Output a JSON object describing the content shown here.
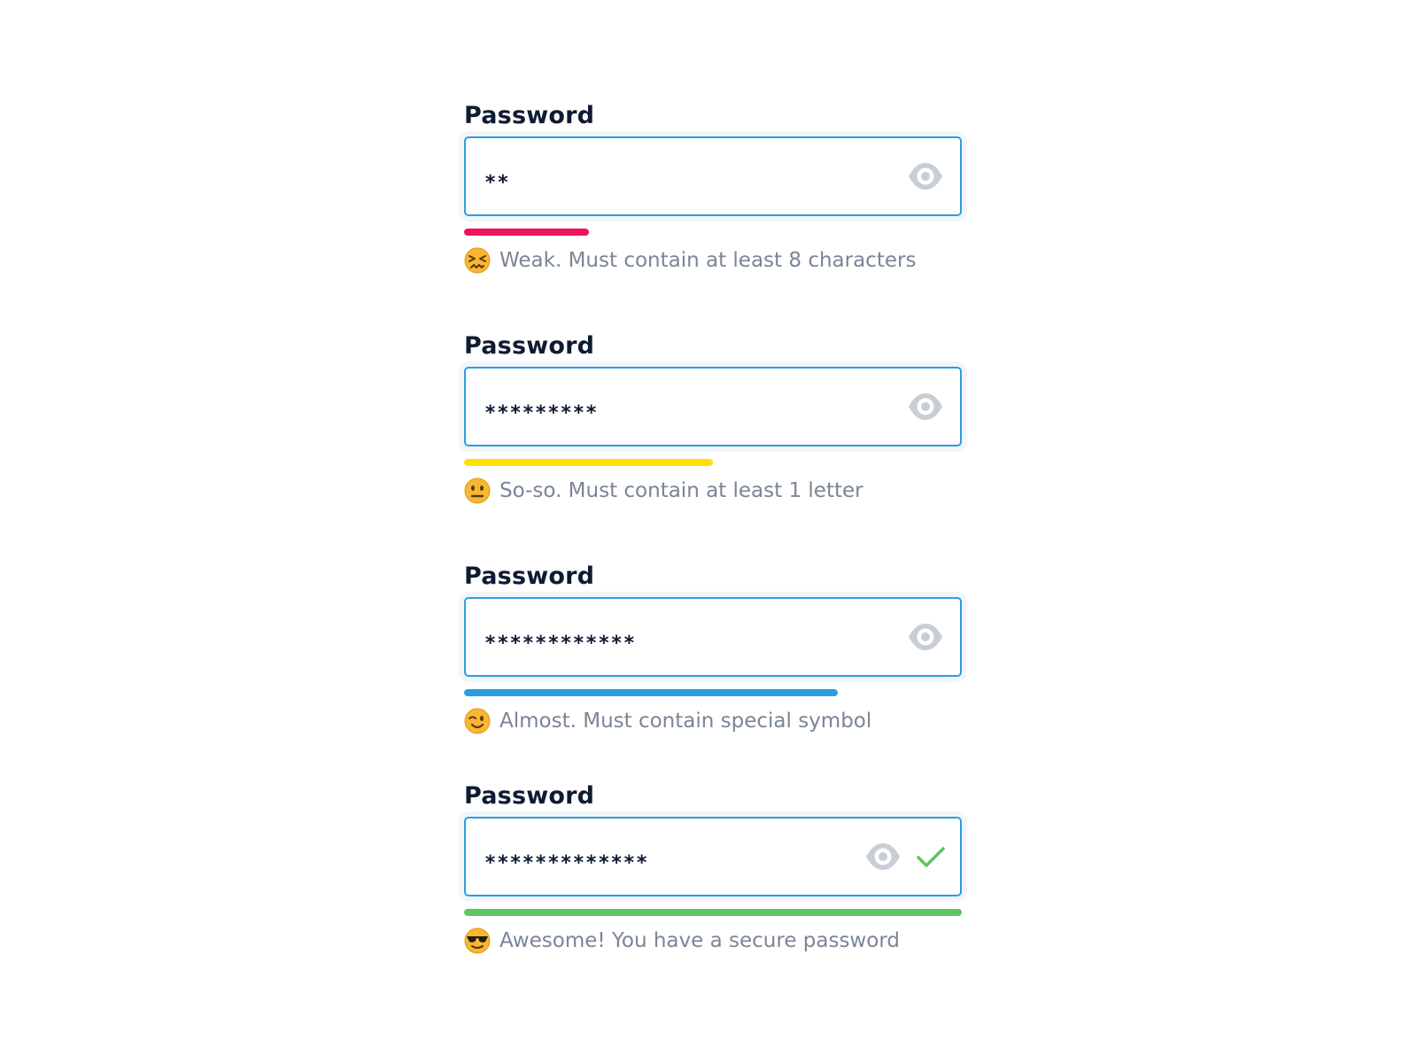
{
  "colors": {
    "border": "#2a9ee0",
    "label": "#0f1b33",
    "hint": "#7a8596",
    "icon": "#c8ced6",
    "success": "#5cc75e"
  },
  "fields": [
    {
      "label": "Password",
      "value": "**",
      "strength": 0.25,
      "strength_color": "#f0145a",
      "emoji": "confounded-face-icon",
      "hint": "Weak. Must contain at least 8 characters",
      "valid": false
    },
    {
      "label": "Password",
      "value": "*********",
      "strength": 0.5,
      "strength_color": "#ffdf0a",
      "emoji": "neutral-face-icon",
      "hint": "So-so. Must contain at least 1 letter",
      "valid": false
    },
    {
      "label": "Password",
      "value": "************",
      "strength": 0.75,
      "strength_color": "#2a9ee0",
      "emoji": "winking-face-icon",
      "hint": "Almost. Must contain special symbol",
      "valid": false
    },
    {
      "label": "Password",
      "value": "*************",
      "strength": 1.0,
      "strength_color": "#5cc75e",
      "emoji": "sunglasses-face-icon",
      "hint": "Awesome! You have a secure password",
      "valid": true
    }
  ]
}
